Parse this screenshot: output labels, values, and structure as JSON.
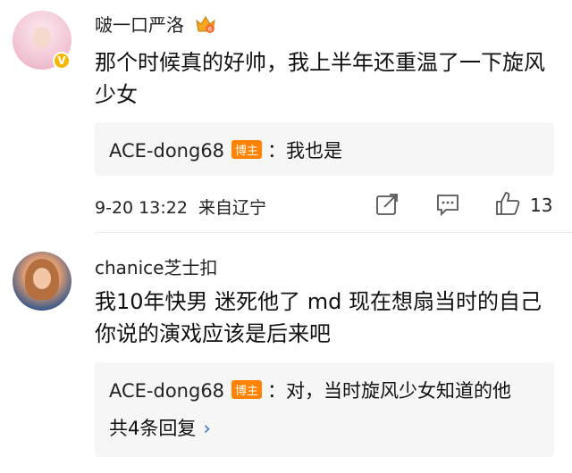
{
  "comments": [
    {
      "username": "啵一口严洛",
      "text": "那个时候真的好帅，我上半年还重温了一下旋风少女",
      "reply": {
        "author": "ACE-dong68",
        "badge": "博主",
        "text": "：我也是"
      },
      "timestamp": "9-20 13:22",
      "location": "来自辽宁",
      "likes": "13"
    },
    {
      "username": "chanice芝士扣",
      "text": "我10年快男 迷死他了  md 现在想扇当时的自己 你说的演戏应该是后来吧",
      "reply": {
        "author": "ACE-dong68",
        "badge": "博主",
        "text": "：对，当时旋风少女知道的他"
      },
      "more_replies": "共4条回复"
    }
  ],
  "icons": {
    "share": "share-icon",
    "comment": "comment-icon",
    "like": "thumbs-up-icon",
    "crown": "crown-badge-icon",
    "verified": "verified-v-icon"
  },
  "colors": {
    "badge": "#ff8200",
    "verified": "#f5b800",
    "reply_bg": "#f6f6f6",
    "link": "#3a6fd8"
  }
}
